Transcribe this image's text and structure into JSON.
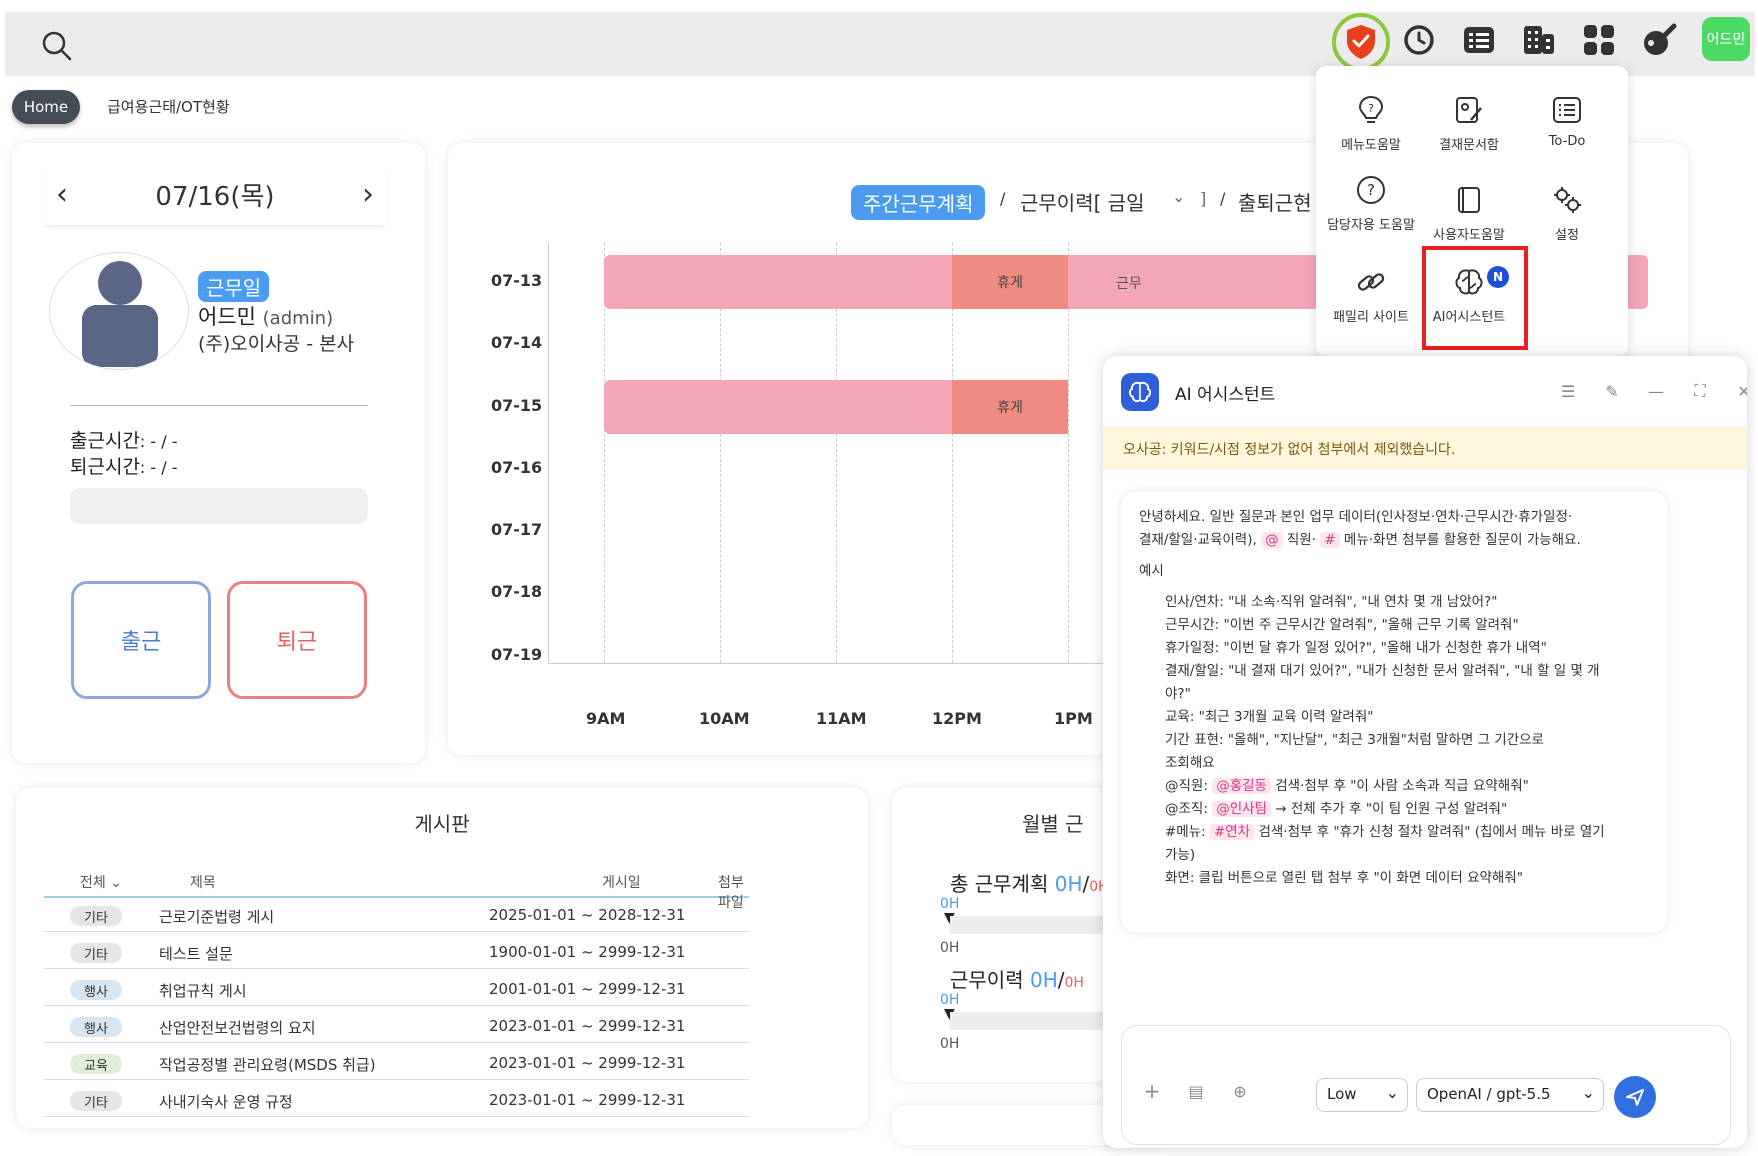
{
  "topbar": {
    "icons": [
      "search-icon",
      "shield-icon",
      "clock-icon",
      "list-icon",
      "building-icon",
      "apps-grid-icon",
      "palette-icon"
    ],
    "user_avatar": "어드민"
  },
  "breadcrumb": {
    "home": "Home",
    "current": "급여용근태/OT현황"
  },
  "attendance": {
    "date": "07/16(목)",
    "badge": "근무일",
    "user_name": "어드민",
    "user_id": "(admin)",
    "company": "(주)오이사공 - 본사",
    "clock_in_label": "출근시간",
    "clock_in_value": ": - / -",
    "clock_out_label": "퇴근시간",
    "clock_out_value": ": - / -",
    "btn_in": "출근",
    "btn_out": "퇴근"
  },
  "schedule": {
    "tab_active": "주간근무계획",
    "sep1": "/",
    "tab2": "근무이력[ 금일",
    "tab2_tail": "]",
    "sep2": "/",
    "tab3": "출퇴근현",
    "rows": [
      "07-13",
      "07-14",
      "07-15",
      "07-16",
      "07-17",
      "07-18",
      "07-19"
    ],
    "hours": [
      "9AM",
      "10AM",
      "11AM",
      "12PM",
      "1PM"
    ],
    "break_label": "휴게",
    "work_label": "근무"
  },
  "board": {
    "title": "게시판",
    "filter": "전체",
    "col_title": "제목",
    "col_date": "게시일",
    "col_file": "첨부파일",
    "rows": [
      {
        "tag": "기타",
        "title": "근로기준법령 게시",
        "date": "2025-01-01 ~ 2028-12-31"
      },
      {
        "tag": "기타",
        "title": "테스트 설문",
        "date": "1900-01-01 ~ 2999-12-31"
      },
      {
        "tag": "행사",
        "title": "취업규칙 게시",
        "date": "2001-01-01 ~ 2999-12-31"
      },
      {
        "tag": "행사",
        "title": "산업안전보건법령의 요지",
        "date": "2023-01-01 ~ 2999-12-31"
      },
      {
        "tag": "교육",
        "title": "작업공정별 관리요령(MSDS 취급)",
        "date": "2023-01-01 ~ 2999-12-31"
      },
      {
        "tag": "기타",
        "title": "사내기숙사 운영 규정",
        "date": "2023-01-01 ~ 2999-12-31"
      }
    ],
    "tag_colors": {
      "기타": "#e6e6e6",
      "행사": "#d6e6f2",
      "교육": "#dff0d8"
    }
  },
  "monthly": {
    "title": "월별 근",
    "plan_label": "총 근무계획",
    "plan_value": "0H",
    "plan_total": "0H",
    "plan_marker": "0H",
    "plan_axis": "0H",
    "history_label": "근무이력",
    "history_value": "0H",
    "history_total": "0H",
    "history_marker": "0H",
    "history_axis": "0H",
    "slash": "/"
  },
  "menu": {
    "items": [
      {
        "icon": "lightbulb-question-icon",
        "label": "메뉴도움말"
      },
      {
        "icon": "approval-doc-icon",
        "label": "결재문서함"
      },
      {
        "icon": "todo-list-icon",
        "label": "To-Do"
      },
      {
        "icon": "question-circle-icon",
        "label": "담당자용 도움말"
      },
      {
        "icon": "book-icon",
        "label": "사용자도움말"
      },
      {
        "icon": "gears-icon",
        "label": "설정"
      },
      {
        "icon": "link-icon",
        "label": "패밀리 사이트"
      },
      {
        "icon": "brain-icon",
        "label": "AI어시스턴트"
      }
    ],
    "new_badge": "N"
  },
  "ai": {
    "title": "AI 어시스턴트",
    "warning": "오사공: 키워드/시점 정보가 없어 첨부에서 제외했습니다.",
    "intro_a": "안녕하세요. 일반 질문과 본인 업무 데이터(인사정보·연차·근무시간·휴가일정·",
    "intro_b1": "결재/할일·교육이력),",
    "intro_at": "@",
    "intro_b2": "직원·",
    "intro_hash": "#",
    "intro_b3": "메뉴·화면 첨부를 활용한 질문이 가능해요.",
    "examples_label": "예시",
    "ex1": "인사/연차: \"내 소속·직위 알려줘\", \"내 연차 몇 개 남았어?\"",
    "ex2": "근무시간: \"이번 주 근무시간 알려줘\", \"올해 근무 기록 알려줘\"",
    "ex3": "휴가일정: \"이번 달 휴가 일정 있어?\", \"올해 내가 신청한 휴가 내역\"",
    "ex4a": "결재/할일: \"내 결재 대기 있어?\", \"내가 신청한 문서 알려줘\", \"내 할 일 몇 개",
    "ex4b": "야?\"",
    "ex5": "교육: \"최근 3개월 교육 이력 알려줘\"",
    "ex6a": "기간 표현: \"올해\", \"지난달\", \"최근 3개월\"처럼 말하면 그 기간으로",
    "ex6b": "조회해요",
    "ex7_pre": "@직원:",
    "ex7_chip": "@홍길동",
    "ex7_post": "검색·첨부 후 \"이 사람 소속과 직급 요약해줘\"",
    "ex8_pre": "@조직:",
    "ex8_chip": "@인사팀",
    "ex8_post": "→ 전체 추가 후 \"이 팀 인원 구성 알려줘\"",
    "ex9_pre": "#메뉴:",
    "ex9_chip": "#연차",
    "ex9_post": "검색·첨부 후 \"휴가 신청 절차 알려줘\" (칩에서 메뉴 바로 열기",
    "ex9b": "가능)",
    "ex10": "화면: 클립 버튼으로 열린 탭 첨부 후 \"이 화면 데이터 요약해줘\"",
    "effort": "Low",
    "model": "OpenAI / gpt-5.5"
  }
}
